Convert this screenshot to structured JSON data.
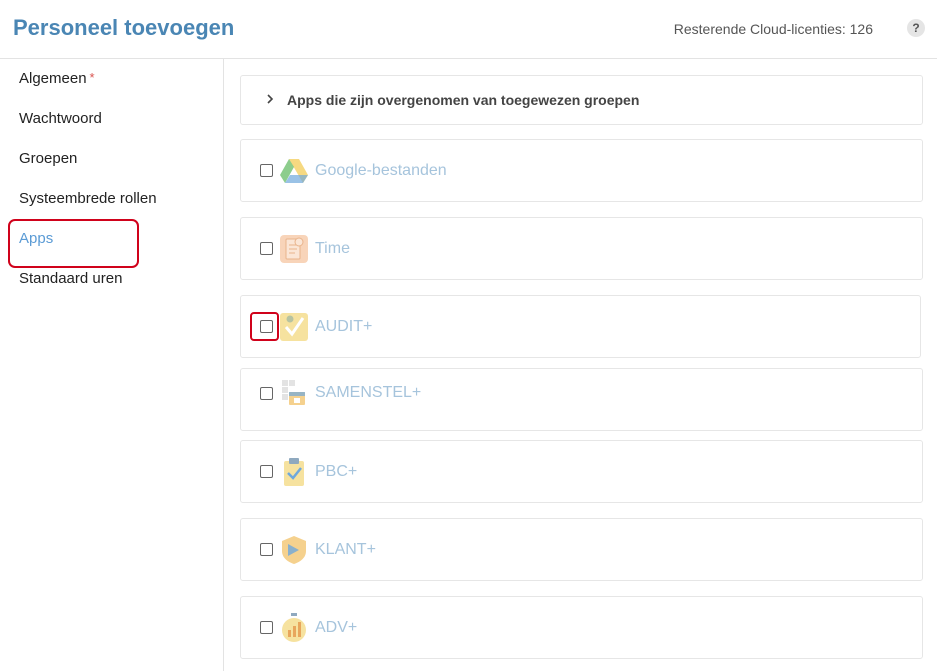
{
  "header": {
    "title": "Personeel toevoegen",
    "licenses": "Resterende Cloud-licenties: 126",
    "help": "?"
  },
  "sidebar": {
    "items": [
      {
        "label": "Algemeen",
        "required": "*"
      },
      {
        "label": "Wachtwoord"
      },
      {
        "label": "Groepen"
      },
      {
        "label": "Systeembrede rollen"
      },
      {
        "label": "Apps",
        "active": true
      },
      {
        "label": "Standaard uren"
      }
    ]
  },
  "main": {
    "inherited_panel": "Apps die zijn overgenomen van toegewezen groepen",
    "apps": [
      {
        "label": "Google-bestanden",
        "icon": "google-drive-icon",
        "checked": false
      },
      {
        "label": "Time",
        "icon": "time-icon",
        "checked": false
      },
      {
        "label": "AUDIT+",
        "icon": "audit-icon",
        "checked": false
      },
      {
        "label": "SAMENSTEL+",
        "icon": "samenstel-icon",
        "checked": false
      },
      {
        "label": "PBC+",
        "icon": "pbc-icon",
        "checked": false
      },
      {
        "label": "KLANT+",
        "icon": "klant-icon",
        "checked": false
      },
      {
        "label": "ADV+",
        "icon": "adv-icon",
        "checked": false
      }
    ]
  },
  "colors": {
    "title": "#4a86b4",
    "active_nav": "#5b9bd5",
    "app_label": "#a6c4dc",
    "highlight": "#d0021b"
  }
}
